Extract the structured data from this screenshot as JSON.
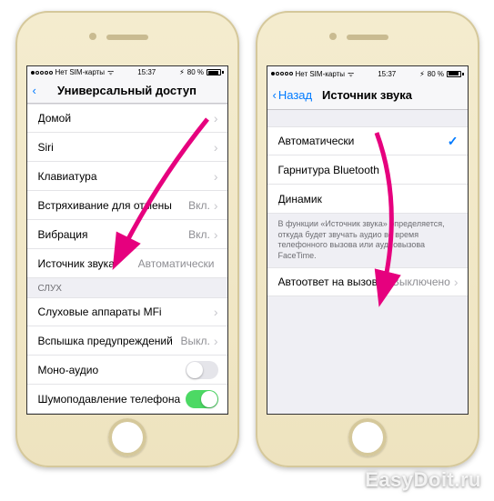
{
  "status": {
    "carrier": "Нет SIM-карты",
    "time": "15:37",
    "battery": "80 %"
  },
  "left": {
    "title": "Универсальный доступ",
    "rows": {
      "home": "Домой",
      "siri": "Siri",
      "keyboard": "Клавиатура",
      "shake": "Встряхивание для отмены",
      "shake_val": "Вкл.",
      "vibration": "Вибрация",
      "vibration_val": "Вкл.",
      "audio_source": "Источник звука",
      "audio_source_val": "Автоматически"
    },
    "section_hearing": "слух",
    "hearing_rows": {
      "mfi": "Слуховые аппараты MFi",
      "flash": "Вспышка предупреждений",
      "flash_val": "Выкл.",
      "mono": "Моно-аудио",
      "noise": "Шумоподавление телефона"
    }
  },
  "right": {
    "back": "Назад",
    "title": "Источник звука",
    "options": {
      "auto": "Автоматически",
      "bt": "Гарнитура Bluetooth",
      "speaker": "Динамик"
    },
    "footer": "В функции «Источник звука» определяется, откуда будет звучать аудио во время телефонного вызова или аудиовызова FaceTime.",
    "auto_answer": "Автоответ на вызовы",
    "auto_answer_val": "Выключено"
  },
  "watermark": "EasyDoit.ru"
}
